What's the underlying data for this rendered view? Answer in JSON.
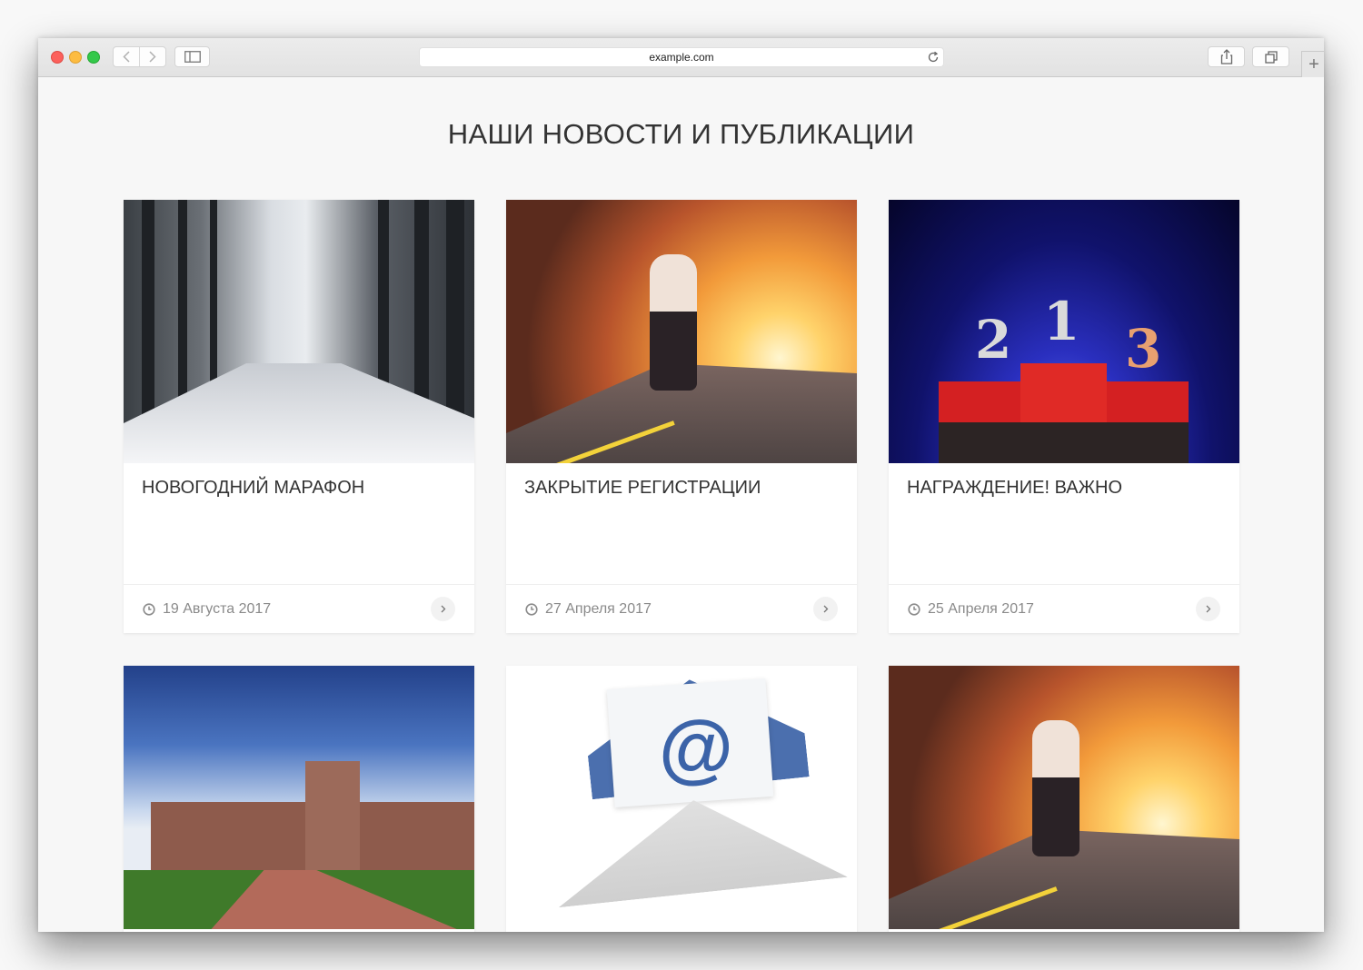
{
  "browser": {
    "url": "example.com",
    "icons": {
      "back": "chevron-left-icon",
      "forward": "chevron-right-icon",
      "sidebar": "sidebar-icon",
      "reload": "reload-icon",
      "share": "share-icon",
      "tabs": "tabs-icon",
      "new_tab": "+"
    }
  },
  "page": {
    "title": "НАШИ НОВОСТИ И ПУБЛИКАЦИИ"
  },
  "cards": [
    {
      "title": "НОВОГОДНИЙ МАРАФОН",
      "date": "19 Августа 2017",
      "image": "snowy-forest-path"
    },
    {
      "title": "ЗАКРЫТИЕ РЕГИСТРАЦИИ",
      "date": "27 Апреля 2017",
      "image": "runner-sunset-road"
    },
    {
      "title": "НАГРАЖДЕНИЕ! ВАЖНО",
      "date": "25 Апреля 2017",
      "image": "award-podium"
    },
    {
      "title": "",
      "date": "",
      "image": "palace"
    },
    {
      "title": "",
      "date": "",
      "image": "email-envelope"
    },
    {
      "title": "",
      "date": "",
      "image": "runner-sunset-road"
    }
  ],
  "podium_labels": [
    "2",
    "1",
    "3"
  ],
  "mail_symbol": "@"
}
